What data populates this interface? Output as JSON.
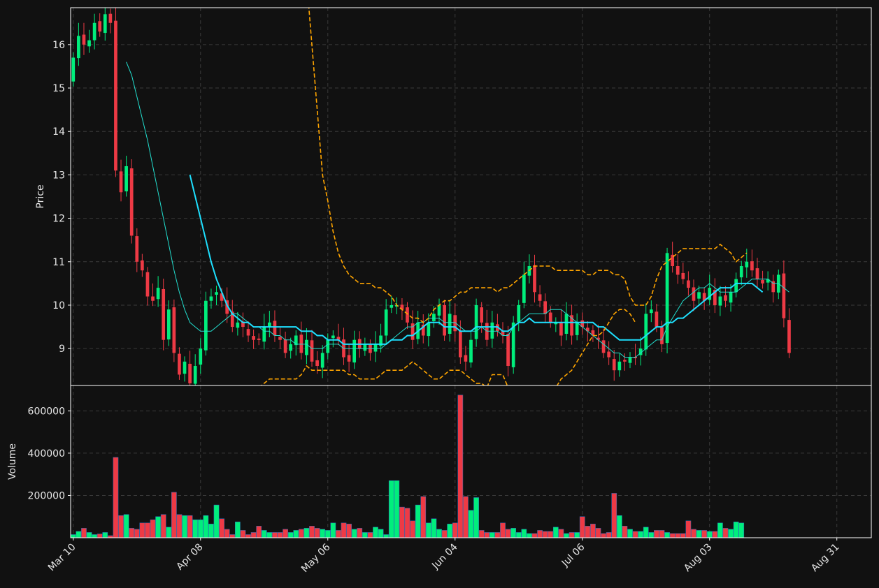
{
  "chart_data": [
    {
      "type": "candlestick",
      "panel": "price",
      "ylabel": "Price",
      "ylim": [
        8.15,
        16.85
      ],
      "yticks": [
        9,
        10,
        11,
        12,
        13,
        14,
        15,
        16
      ],
      "grid": true,
      "x_range": [
        -0.5,
        150.5
      ],
      "xticks": [
        {
          "index": 0,
          "label": "Mar 10"
        },
        {
          "index": 24,
          "label": "Apr 08"
        },
        {
          "index": 48,
          "label": "May 06"
        },
        {
          "index": 72,
          "label": "Jun 04"
        },
        {
          "index": 96,
          "label": "Jul 06"
        },
        {
          "index": 120,
          "label": "Aug 03"
        },
        {
          "index": 144,
          "label": "Aug 31"
        }
      ],
      "closes": [
        15.7,
        16.2,
        16.0,
        16.1,
        16.5,
        16.3,
        16.7,
        16.5,
        13.1,
        12.6,
        13.2,
        11.6,
        11.0,
        10.8,
        10.2,
        10.1,
        10.4,
        9.2,
        9.9,
        8.9,
        8.4,
        8.7,
        8.2,
        8.6,
        9.0,
        10.1,
        10.2,
        10.3,
        10.1,
        9.8,
        9.5,
        9.6,
        9.5,
        9.3,
        9.2,
        9.2,
        9.5,
        9.6,
        9.3,
        9.2,
        8.9,
        9.1,
        9.3,
        8.9,
        9.2,
        8.7,
        8.6,
        8.9,
        9.2,
        9.3,
        9.2,
        8.8,
        8.7,
        9.2,
        9.0,
        9.1,
        8.9,
        9.1,
        9.3,
        9.9,
        10.0,
        10.0,
        9.9,
        9.6,
        9.2,
        9.6,
        9.3,
        9.6,
        9.8,
        10.0,
        9.3,
        9.8,
        9.4,
        8.8,
        8.7,
        9.2,
        10.0,
        9.6,
        9.2,
        9.6,
        9.4,
        9.3,
        8.6,
        9.6,
        10.0,
        10.7,
        10.9,
        10.3,
        10.1,
        9.8,
        9.6,
        9.6,
        9.3,
        9.8,
        9.3,
        9.6,
        9.5,
        9.4,
        9.3,
        9.2,
        8.9,
        8.8,
        8.5,
        8.7,
        8.7,
        8.8,
        8.8,
        9.0,
        9.8,
        9.9,
        9.5,
        9.1,
        11.2,
        10.9,
        10.7,
        10.6,
        10.4,
        10.1,
        10.3,
        10.1,
        10.4,
        10.0,
        10.2,
        10.1,
        10.3,
        10.6,
        10.9,
        11.0,
        10.8,
        10.6,
        10.5,
        10.6,
        10.3,
        10.7,
        9.7,
        8.9
      ],
      "series": [
        {
          "name": "",
          "color": "#22e0d0",
          "values": [
            null,
            null,
            null,
            null,
            null,
            null,
            null,
            null,
            null,
            null,
            15.6,
            15.3,
            14.8,
            14.3,
            13.8,
            13.2,
            12.6,
            12.0,
            11.4,
            10.8,
            10.3,
            9.9,
            9.6,
            9.5,
            9.4,
            9.4,
            9.4,
            9.5,
            9.6,
            9.7,
            9.8,
            9.8,
            9.7,
            9.6,
            9.5,
            9.5,
            9.4,
            9.4,
            9.3,
            9.3,
            9.2,
            9.2,
            9.1,
            9.1,
            9.1,
            9.0,
            9.0,
            9.0,
            9.1,
            9.1,
            9.1,
            9.0,
            9.0,
            9.0,
            9.0,
            9.0,
            9.0,
            9.0,
            9.0,
            9.1,
            9.2,
            9.3,
            9.4,
            9.5,
            9.5,
            9.6,
            9.6,
            9.7,
            9.7,
            9.7,
            9.6,
            9.6,
            9.6,
            9.5,
            9.4,
            9.4,
            9.4,
            9.5,
            9.4,
            9.4,
            9.4,
            9.3,
            9.3,
            9.5,
            9.6,
            9.7,
            9.8,
            9.8,
            9.8,
            9.8,
            9.9,
            9.9,
            9.9,
            9.8,
            9.7,
            9.6,
            9.5,
            9.4,
            9.3,
            9.2,
            9.1,
            9.0,
            8.9,
            8.9,
            8.8,
            8.8,
            8.8,
            8.9,
            9.0,
            9.1,
            9.2,
            9.2,
            9.5,
            9.7,
            9.9,
            10.1,
            10.2,
            10.3,
            10.4,
            10.4,
            10.5,
            10.4,
            10.3,
            10.3,
            10.3,
            10.3,
            10.4,
            10.5,
            10.6,
            10.6,
            10.6,
            10.6,
            10.5,
            10.5,
            10.4,
            10.3
          ]
        },
        {
          "name": "",
          "color": "#1ee0ff",
          "values": [
            null,
            null,
            null,
            null,
            null,
            null,
            null,
            null,
            null,
            null,
            null,
            null,
            null,
            null,
            null,
            null,
            null,
            null,
            null,
            null,
            null,
            null,
            13.0,
            12.5,
            12.0,
            11.5,
            11.0,
            10.6,
            10.3,
            10.0,
            9.8,
            9.7,
            9.6,
            9.6,
            9.5,
            9.5,
            9.5,
            9.5,
            9.5,
            9.5,
            9.5,
            9.5,
            9.5,
            9.4,
            9.4,
            9.4,
            9.3,
            9.3,
            9.2,
            9.2,
            9.2,
            9.1,
            9.1,
            9.1,
            9.1,
            9.1,
            9.1,
            9.1,
            9.1,
            9.1,
            9.2,
            9.2,
            9.2,
            9.3,
            9.3,
            9.4,
            9.5,
            9.6,
            9.6,
            9.6,
            9.5,
            9.5,
            9.5,
            9.4,
            9.4,
            9.4,
            9.5,
            9.5,
            9.5,
            9.5,
            9.5,
            9.4,
            9.4,
            9.5,
            9.6,
            9.6,
            9.7,
            9.6,
            9.6,
            9.6,
            9.6,
            9.6,
            9.6,
            9.6,
            9.6,
            9.6,
            9.6,
            9.6,
            9.6,
            9.5,
            9.5,
            9.4,
            9.3,
            9.2,
            9.2,
            9.2,
            9.2,
            9.2,
            9.3,
            9.4,
            9.5,
            9.5,
            9.6,
            9.6,
            9.7,
            9.7,
            9.8,
            9.9,
            10.0,
            10.1,
            10.2,
            10.3,
            10.4,
            10.4,
            10.4,
            10.5,
            10.5,
            10.5,
            10.5,
            10.4,
            10.3
          ]
        },
        {
          "name": "",
          "color": "#ffa500",
          "dashed": true,
          "values": [
            null,
            null,
            null,
            null,
            null,
            null,
            null,
            null,
            null,
            null,
            null,
            null,
            null,
            null,
            null,
            null,
            null,
            null,
            null,
            null,
            null,
            null,
            17.5,
            16.0,
            14.5,
            13.0,
            12.4,
            11.7,
            11.2,
            10.9,
            10.7,
            10.6,
            10.5,
            10.5,
            10.5,
            10.4,
            10.4,
            10.3,
            10.2,
            10.0,
            9.9,
            9.8,
            9.7,
            9.7,
            9.6,
            9.7,
            9.9,
            10.0,
            10.1,
            10.1,
            10.2,
            10.3,
            10.3,
            10.4,
            10.4,
            10.4,
            10.4,
            10.4,
            10.3,
            10.4,
            10.4,
            10.5,
            10.6,
            10.7,
            10.8,
            10.9,
            10.9,
            10.9,
            10.9,
            10.8,
            10.8,
            10.8,
            10.8,
            10.8,
            10.8,
            10.7,
            10.7,
            10.8,
            10.8,
            10.8,
            10.7,
            10.7,
            10.6,
            10.2,
            10.0,
            10.0,
            10.0,
            10.2,
            10.6,
            10.9,
            11.0,
            11.1,
            11.2,
            11.3,
            11.3,
            11.3,
            11.3,
            11.3,
            11.3,
            11.3,
            11.4,
            11.3,
            11.2,
            11.0,
            11.1,
            11.2
          ],
          "start_index": 22
        },
        {
          "name": "",
          "color": "#ffa500",
          "dashed": true,
          "values": [
            8.1,
            8.2,
            8.3,
            8.3,
            8.3,
            8.3,
            8.3,
            8.3,
            8.4,
            8.6,
            8.5,
            8.5,
            8.5,
            8.5,
            8.5,
            8.5,
            8.5,
            8.4,
            8.4,
            8.3,
            8.3,
            8.3,
            8.3,
            8.4,
            8.5,
            8.5,
            8.5,
            8.5,
            8.6,
            8.7,
            8.6,
            8.5,
            8.4,
            8.3,
            8.3,
            8.4,
            8.5,
            8.5,
            8.5,
            8.4,
            8.3,
            8.2,
            8.2,
            8.1,
            8.4,
            8.4,
            8.4,
            8.1,
            8.0,
            8.0,
            7.9,
            7.8,
            7.7,
            7.6,
            7.8,
            8.0,
            8.1,
            8.3,
            8.4,
            8.5,
            8.7,
            8.9,
            9.1,
            9.3,
            9.3,
            9.4,
            9.6,
            9.8,
            9.9,
            9.9,
            9.8,
            9.6
          ],
          "start_index": 35
        }
      ]
    },
    {
      "type": "bar",
      "panel": "volume",
      "ylabel": "Volume",
      "ylim": [
        0,
        720000
      ],
      "yticks": [
        200000,
        400000,
        600000
      ],
      "grid": true,
      "values": [
        15000,
        30000,
        45000,
        25000,
        15000,
        18000,
        25000,
        10000,
        380000,
        105000,
        110000,
        45000,
        40000,
        70000,
        70000,
        85000,
        100000,
        110000,
        50000,
        215000,
        110000,
        105000,
        105000,
        85000,
        85000,
        105000,
        65000,
        155000,
        90000,
        40000,
        15000,
        75000,
        35000,
        15000,
        25000,
        55000,
        35000,
        25000,
        25000,
        25000,
        40000,
        25000,
        35000,
        40000,
        45000,
        55000,
        45000,
        40000,
        35000,
        70000,
        35000,
        70000,
        65000,
        40000,
        45000,
        25000,
        25000,
        50000,
        40000,
        15000,
        270000,
        270000,
        145000,
        140000,
        80000,
        155000,
        195000,
        70000,
        90000,
        40000,
        35000,
        65000,
        70000,
        675000,
        195000,
        130000,
        190000,
        35000,
        25000,
        25000,
        25000,
        70000,
        40000,
        45000,
        25000,
        40000,
        20000,
        20000,
        35000,
        30000,
        30000,
        50000,
        40000,
        20000,
        25000,
        25000,
        100000,
        55000,
        65000,
        45000,
        20000,
        25000,
        210000,
        105000,
        55000,
        40000,
        30000,
        30000,
        50000,
        25000,
        35000,
        35000,
        25000,
        20000,
        20000,
        20000,
        80000,
        40000,
        35000,
        35000,
        30000,
        30000,
        70000,
        45000,
        40000,
        75000,
        70000
      ]
    }
  ]
}
